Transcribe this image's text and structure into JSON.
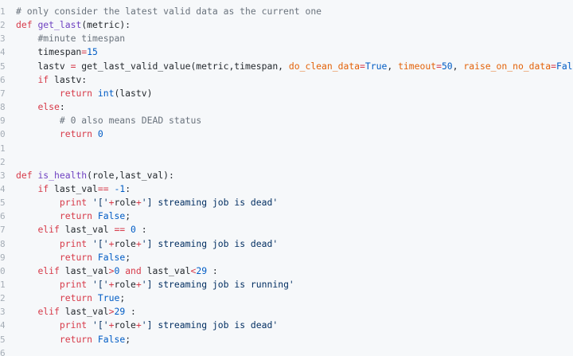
{
  "editor": {
    "gutter_numbers": [
      "1",
      "2",
      "3",
      "4",
      "5",
      "6",
      "7",
      "8",
      "9",
      "0",
      "1",
      "2",
      "3",
      "4",
      "5",
      "6",
      "7",
      "8",
      "9",
      "0",
      "1",
      "2",
      "3",
      "4",
      "5",
      "6"
    ],
    "lines": [
      [
        {
          "t": "# only consider the latest valid data as the current one",
          "c": "cm"
        }
      ],
      [
        {
          "t": "def ",
          "c": "kw"
        },
        {
          "t": "get_last",
          "c": "fn"
        },
        {
          "t": "(metric):",
          "c": ""
        }
      ],
      [
        {
          "t": "    ",
          "c": ""
        },
        {
          "t": "#minute timespan",
          "c": "cm"
        }
      ],
      [
        {
          "t": "    timespan",
          "c": ""
        },
        {
          "t": "=",
          "c": "op"
        },
        {
          "t": "15",
          "c": "num"
        }
      ],
      [
        {
          "t": "    lastv ",
          "c": ""
        },
        {
          "t": "=",
          "c": "op"
        },
        {
          "t": " get_last_valid_value(metric,timespan, ",
          "c": ""
        },
        {
          "t": "do_clean_data",
          "c": "pa"
        },
        {
          "t": "=",
          "c": "op"
        },
        {
          "t": "True",
          "c": "bi"
        },
        {
          "t": ", ",
          "c": ""
        },
        {
          "t": "timeout",
          "c": "pa"
        },
        {
          "t": "=",
          "c": "op"
        },
        {
          "t": "50",
          "c": "num"
        },
        {
          "t": ", ",
          "c": ""
        },
        {
          "t": "raise_on_no_data",
          "c": "pa"
        },
        {
          "t": "=",
          "c": "op"
        },
        {
          "t": "False",
          "c": "bi"
        },
        {
          "t": ")",
          "c": ""
        }
      ],
      [
        {
          "t": "    ",
          "c": ""
        },
        {
          "t": "if",
          "c": "kw"
        },
        {
          "t": " lastv:",
          "c": ""
        }
      ],
      [
        {
          "t": "        ",
          "c": ""
        },
        {
          "t": "return",
          "c": "kw"
        },
        {
          "t": " ",
          "c": ""
        },
        {
          "t": "int",
          "c": "bi"
        },
        {
          "t": "(lastv)",
          "c": ""
        }
      ],
      [
        {
          "t": "    ",
          "c": ""
        },
        {
          "t": "else",
          "c": "kw"
        },
        {
          "t": ":",
          "c": ""
        }
      ],
      [
        {
          "t": "        ",
          "c": ""
        },
        {
          "t": "# 0 also means DEAD status",
          "c": "cm"
        }
      ],
      [
        {
          "t": "        ",
          "c": ""
        },
        {
          "t": "return",
          "c": "kw"
        },
        {
          "t": " ",
          "c": ""
        },
        {
          "t": "0",
          "c": "num"
        }
      ],
      [],
      [],
      [
        {
          "t": "def ",
          "c": "kw"
        },
        {
          "t": "is_health",
          "c": "fn"
        },
        {
          "t": "(role,last_val):",
          "c": ""
        }
      ],
      [
        {
          "t": "    ",
          "c": ""
        },
        {
          "t": "if",
          "c": "kw"
        },
        {
          "t": " last_val",
          "c": ""
        },
        {
          "t": "==",
          "c": "op"
        },
        {
          "t": " ",
          "c": ""
        },
        {
          "t": "-1",
          "c": "num"
        },
        {
          "t": ":",
          "c": ""
        }
      ],
      [
        {
          "t": "        ",
          "c": ""
        },
        {
          "t": "print",
          "c": "kw"
        },
        {
          "t": " ",
          "c": ""
        },
        {
          "t": "'['",
          "c": "str"
        },
        {
          "t": "+",
          "c": "op"
        },
        {
          "t": "role",
          "c": ""
        },
        {
          "t": "+",
          "c": "op"
        },
        {
          "t": "'] streaming job is dead'",
          "c": "str"
        }
      ],
      [
        {
          "t": "        ",
          "c": ""
        },
        {
          "t": "return",
          "c": "kw"
        },
        {
          "t": " ",
          "c": ""
        },
        {
          "t": "False",
          "c": "bi"
        },
        {
          "t": ";",
          "c": ""
        }
      ],
      [
        {
          "t": "    ",
          "c": ""
        },
        {
          "t": "elif",
          "c": "kw"
        },
        {
          "t": " last_val ",
          "c": ""
        },
        {
          "t": "==",
          "c": "op"
        },
        {
          "t": " ",
          "c": ""
        },
        {
          "t": "0",
          "c": "num"
        },
        {
          "t": " :",
          "c": ""
        }
      ],
      [
        {
          "t": "        ",
          "c": ""
        },
        {
          "t": "print",
          "c": "kw"
        },
        {
          "t": " ",
          "c": ""
        },
        {
          "t": "'['",
          "c": "str"
        },
        {
          "t": "+",
          "c": "op"
        },
        {
          "t": "role",
          "c": ""
        },
        {
          "t": "+",
          "c": "op"
        },
        {
          "t": "'] streaming job is dead'",
          "c": "str"
        }
      ],
      [
        {
          "t": "        ",
          "c": ""
        },
        {
          "t": "return",
          "c": "kw"
        },
        {
          "t": " ",
          "c": ""
        },
        {
          "t": "False",
          "c": "bi"
        },
        {
          "t": ";",
          "c": ""
        }
      ],
      [
        {
          "t": "    ",
          "c": ""
        },
        {
          "t": "elif",
          "c": "kw"
        },
        {
          "t": " last_val",
          "c": ""
        },
        {
          "t": ">",
          "c": "op"
        },
        {
          "t": "0",
          "c": "num"
        },
        {
          "t": " ",
          "c": ""
        },
        {
          "t": "and",
          "c": "kw"
        },
        {
          "t": " last_val",
          "c": ""
        },
        {
          "t": "<",
          "c": "op"
        },
        {
          "t": "29",
          "c": "num"
        },
        {
          "t": " :",
          "c": ""
        }
      ],
      [
        {
          "t": "        ",
          "c": ""
        },
        {
          "t": "print",
          "c": "kw"
        },
        {
          "t": " ",
          "c": ""
        },
        {
          "t": "'['",
          "c": "str"
        },
        {
          "t": "+",
          "c": "op"
        },
        {
          "t": "role",
          "c": ""
        },
        {
          "t": "+",
          "c": "op"
        },
        {
          "t": "'] streaming job is running'",
          "c": "str"
        }
      ],
      [
        {
          "t": "        ",
          "c": ""
        },
        {
          "t": "return",
          "c": "kw"
        },
        {
          "t": " ",
          "c": ""
        },
        {
          "t": "True",
          "c": "bi"
        },
        {
          "t": ";",
          "c": ""
        }
      ],
      [
        {
          "t": "    ",
          "c": ""
        },
        {
          "t": "elif",
          "c": "kw"
        },
        {
          "t": " last_val",
          "c": ""
        },
        {
          "t": ">",
          "c": "op"
        },
        {
          "t": "29",
          "c": "num"
        },
        {
          "t": " :",
          "c": ""
        }
      ],
      [
        {
          "t": "        ",
          "c": ""
        },
        {
          "t": "print",
          "c": "kw"
        },
        {
          "t": " ",
          "c": ""
        },
        {
          "t": "'['",
          "c": "str"
        },
        {
          "t": "+",
          "c": "op"
        },
        {
          "t": "role",
          "c": ""
        },
        {
          "t": "+",
          "c": "op"
        },
        {
          "t": "'] streaming job is dead'",
          "c": "str"
        }
      ],
      [
        {
          "t": "        ",
          "c": ""
        },
        {
          "t": "return",
          "c": "kw"
        },
        {
          "t": " ",
          "c": ""
        },
        {
          "t": "False",
          "c": "bi"
        },
        {
          "t": ";",
          "c": ""
        }
      ]
    ]
  },
  "colors": {
    "background": "#f6f8fa",
    "keyword": "#d73a49",
    "function": "#6f42c1",
    "number": "#005cc5",
    "string": "#032f62",
    "comment": "#6a737d",
    "parameter": "#e36209"
  }
}
